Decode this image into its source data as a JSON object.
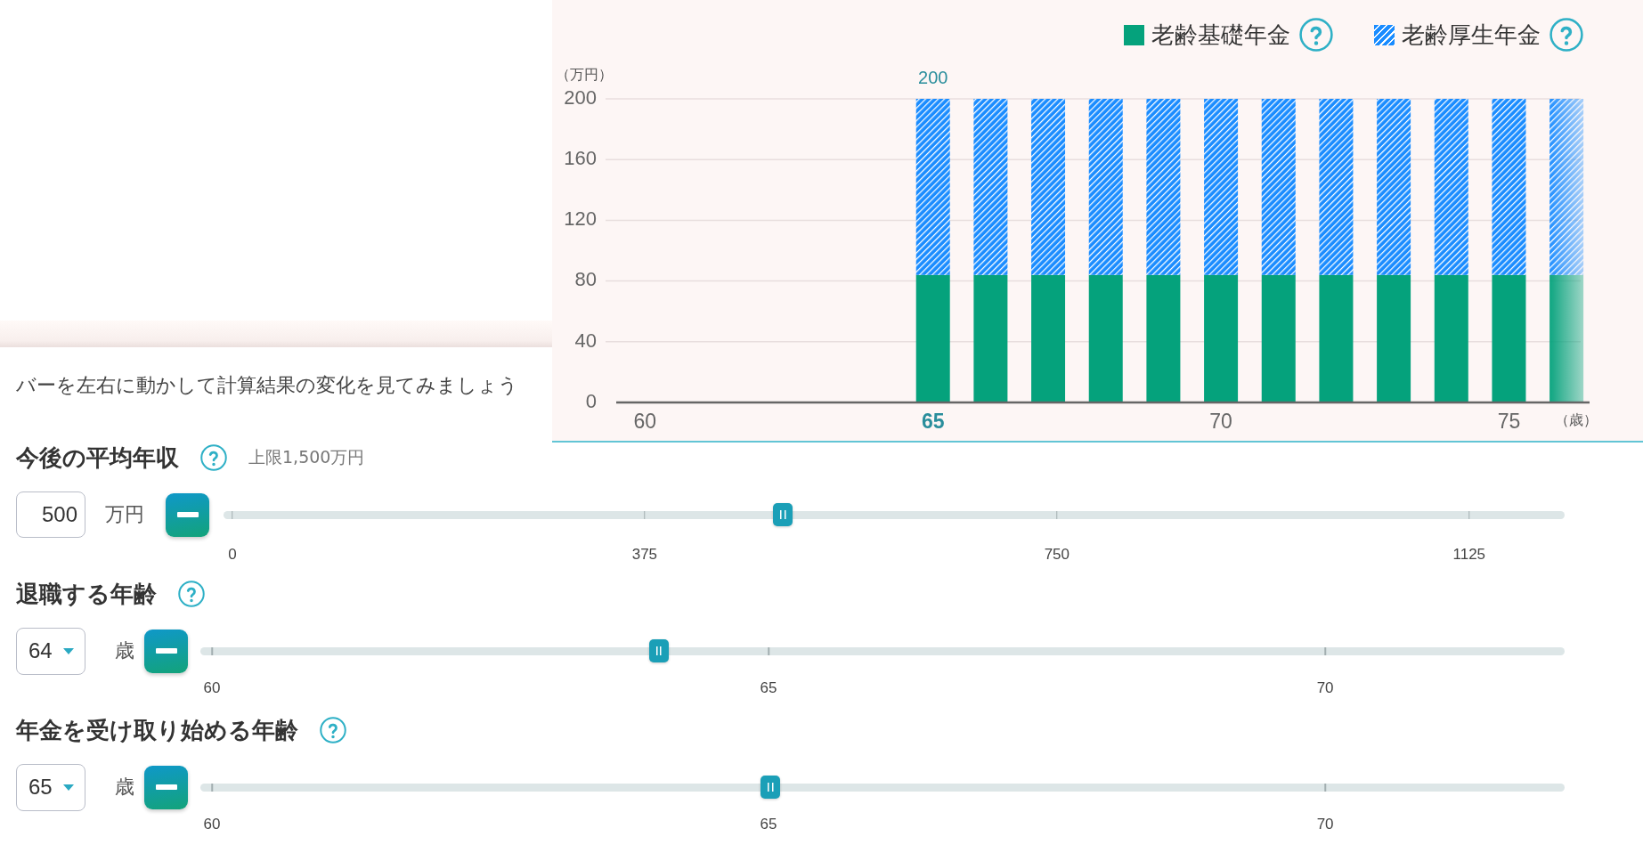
{
  "chart": {
    "chart_data": {
      "type": "bar",
      "stacked": true,
      "legend": "top-right",
      "grid": true,
      "xlabel": "（歳）",
      "ylabel": "（万円）",
      "x": [
        60,
        61,
        62,
        63,
        64,
        65,
        66,
        67,
        68,
        69,
        70,
        71,
        72,
        73,
        74,
        75,
        76
      ],
      "xlim": [
        59.5,
        76.4
      ],
      "xticks": [
        60,
        65,
        70,
        75
      ],
      "yticks": [
        0,
        40,
        80,
        120,
        160,
        200
      ],
      "ylim": [
        0,
        200
      ],
      "series": [
        {
          "name": "老齢基礎年金",
          "color": "#05a27c",
          "values": [
            0,
            0,
            0,
            0,
            0,
            84,
            84,
            84,
            84,
            84,
            84,
            84,
            84,
            84,
            84,
            84,
            84
          ]
        },
        {
          "name": "老齢厚生年金",
          "color": "#1a8cff",
          "values": [
            0,
            0,
            0,
            0,
            0,
            116,
            116,
            116,
            116,
            116,
            116,
            116,
            116,
            116,
            116,
            116,
            116
          ]
        }
      ],
      "annotations": [
        {
          "x": 65,
          "y": 200,
          "text": "200"
        }
      ]
    }
  },
  "instruction": "バーを左右に動かして計算結果の変化を見てみましょう",
  "sliders": [
    {
      "kind": "income",
      "label": "今後の平均年収",
      "note": "上限1,500万円",
      "value": "500",
      "unit": "万円",
      "level": 0.417,
      "ticks": [
        "0",
        "375",
        "750",
        "1125"
      ]
    },
    {
      "kind": "age",
      "label": "退職する年齢",
      "value": "64",
      "unit": "歳",
      "level": 0.336,
      "ticks": [
        "60",
        "65",
        "70"
      ]
    },
    {
      "kind": "age",
      "label": "年金を受け取り始める年齢",
      "value": "65",
      "unit": "歳",
      "level": 0.418,
      "ticks": [
        "60",
        "65",
        "70"
      ]
    }
  ]
}
